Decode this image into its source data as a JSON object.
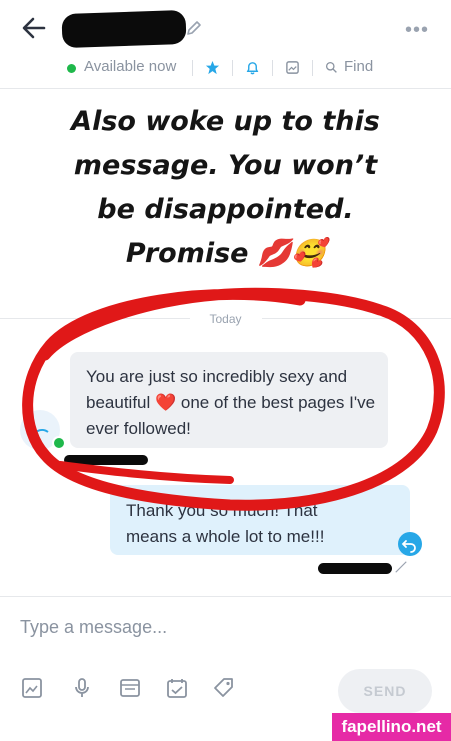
{
  "header": {
    "status": "Available now",
    "find_label": "Find"
  },
  "overlay_text": {
    "line1": "Also woke up to this",
    "line2": "message. You won’t",
    "line3": "be disappointed.",
    "line4": "Promise 💋🥰"
  },
  "chat": {
    "date_divider": "Today",
    "incoming": {
      "text": "You are just so incredibly sexy and beautiful ❤️ one of the best pages I've ever followed!"
    },
    "outgoing": {
      "text_line1": "Thank you so much! That",
      "text_line2": "means a whole lot to me!!!"
    }
  },
  "composer": {
    "placeholder": "Type a message...",
    "send_label": "SEND"
  },
  "watermark": "fapellino.net",
  "colors": {
    "online": "#1fb84b",
    "accent": "#27a7e7",
    "scribble": "#e01818",
    "outgoing_bubble": "#dff1fc",
    "incoming_bubble": "#eef0f3",
    "watermark_bg": "#e62aa6"
  },
  "icons": [
    "back-arrow-icon",
    "edit-pencil-icon",
    "more-options-icon",
    "star-icon",
    "bell-icon",
    "gallery-icon",
    "search-icon",
    "image-icon",
    "microphone-icon",
    "vault-icon",
    "schedule-icon",
    "price-tag-icon",
    "reply-icon"
  ]
}
